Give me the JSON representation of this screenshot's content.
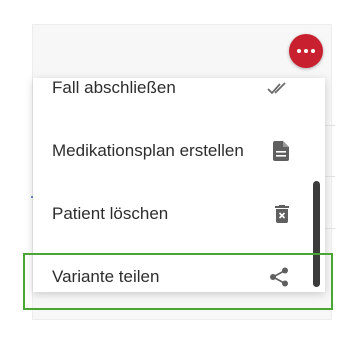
{
  "more_button": {
    "icon": "more-horizontal-icon",
    "color": "#c8202f"
  },
  "menu": {
    "items": [
      {
        "label": "Fall abschließen",
        "icon": "double-check-icon"
      },
      {
        "label": "Medikationsplan erstellen",
        "icon": "document-icon"
      },
      {
        "label": "Patient löschen",
        "icon": "trash-icon"
      },
      {
        "label": "Variante teilen",
        "icon": "share-icon"
      }
    ]
  },
  "highlight": {
    "color": "#4aa532",
    "target": "Variante teilen"
  }
}
